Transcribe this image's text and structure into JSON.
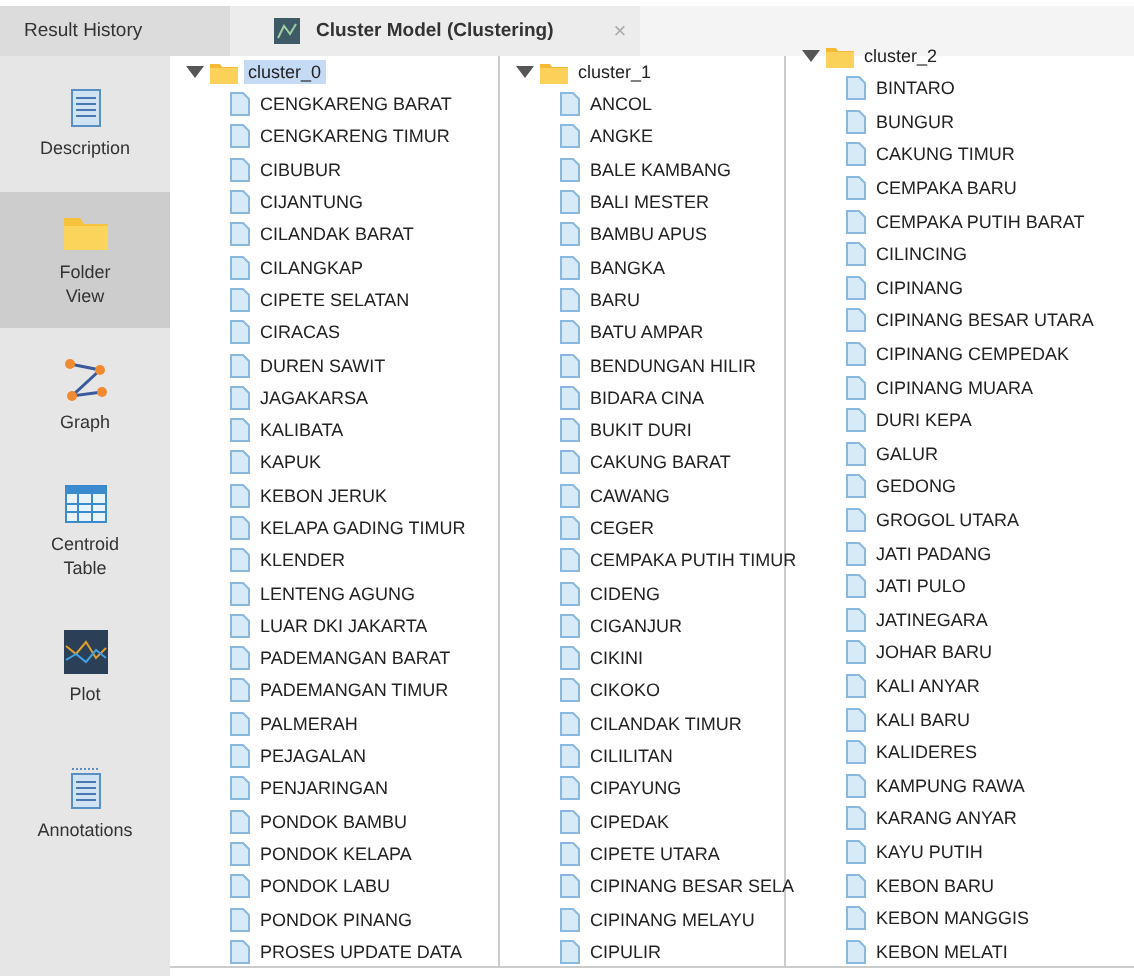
{
  "tabs": [
    {
      "label": "Result History",
      "selected": false
    },
    {
      "label": "Cluster Model (Clustering)",
      "selected": true,
      "close": "×"
    }
  ],
  "sidebar": {
    "items": [
      {
        "label": "Description",
        "selected": false
      },
      {
        "label": "Folder View",
        "selected": true
      },
      {
        "label": "Graph",
        "selected": false
      },
      {
        "label": "Centroid Table",
        "selected": false
      },
      {
        "label": "Plot",
        "selected": false
      },
      {
        "label": "Annotations",
        "selected": false
      }
    ]
  },
  "clusters": [
    {
      "name": "cluster_0",
      "selected": true,
      "expanded": true,
      "items": [
        "CENGKARENG BARAT",
        "CENGKARENG TIMUR",
        "CIBUBUR",
        "CIJANTUNG",
        "CILANDAK BARAT",
        "CILANGKAP",
        "CIPETE SELATAN",
        "CIRACAS",
        "DUREN SAWIT",
        "JAGAKARSA",
        "KALIBATA",
        "KAPUK",
        "KEBON JERUK",
        "KELAPA GADING TIMUR",
        "KLENDER",
        "LENTENG AGUNG",
        "LUAR DKI JAKARTA",
        "PADEMANGAN BARAT",
        "PADEMANGAN TIMUR",
        "PALMERAH",
        "PEJAGALAN",
        "PENJARINGAN",
        "PONDOK BAMBU",
        "PONDOK KELAPA",
        "PONDOK LABU",
        "PONDOK PINANG",
        "PROSES UPDATE DATA"
      ]
    },
    {
      "name": "cluster_1",
      "selected": false,
      "expanded": true,
      "items": [
        "ANCOL",
        "ANGKE",
        "BALE KAMBANG",
        "BALI MESTER",
        "BAMBU APUS",
        "BANGKA",
        "BARU",
        "BATU AMPAR",
        "BENDUNGAN HILIR",
        "BIDARA CINA",
        "BUKIT DURI",
        "CAKUNG BARAT",
        "CAWANG",
        "CEGER",
        "CEMPAKA PUTIH TIMUR",
        "CIDENG",
        "CIGANJUR",
        "CIKINI",
        "CIKOKO",
        "CILANDAK TIMUR",
        "CILILITAN",
        "CIPAYUNG",
        "CIPEDAK",
        "CIPETE UTARA",
        "CIPINANG BESAR SELA",
        "CIPINANG MELAYU",
        "CIPULIR"
      ]
    },
    {
      "name": "cluster_2",
      "selected": false,
      "expanded": true,
      "items": [
        "BINTARO",
        "BUNGUR",
        "CAKUNG TIMUR",
        "CEMPAKA BARU",
        "CEMPAKA PUTIH BARAT",
        "CILINCING",
        "CIPINANG",
        "CIPINANG BESAR UTARA",
        "CIPINANG CEMPEDAK",
        "CIPINANG MUARA",
        "DURI KEPA",
        "GALUR",
        "GEDONG",
        "GROGOL UTARA",
        "JATI PADANG",
        "JATI PULO",
        "JATINEGARA",
        "JOHAR BARU",
        "KALI ANYAR",
        "KALI BARU",
        "KALIDERES",
        "KAMPUNG RAWA",
        "KARANG ANYAR",
        "KAYU PUTIH",
        "KEBON BARU",
        "KEBON MANGGIS",
        "KEBON MELATI"
      ]
    }
  ]
}
